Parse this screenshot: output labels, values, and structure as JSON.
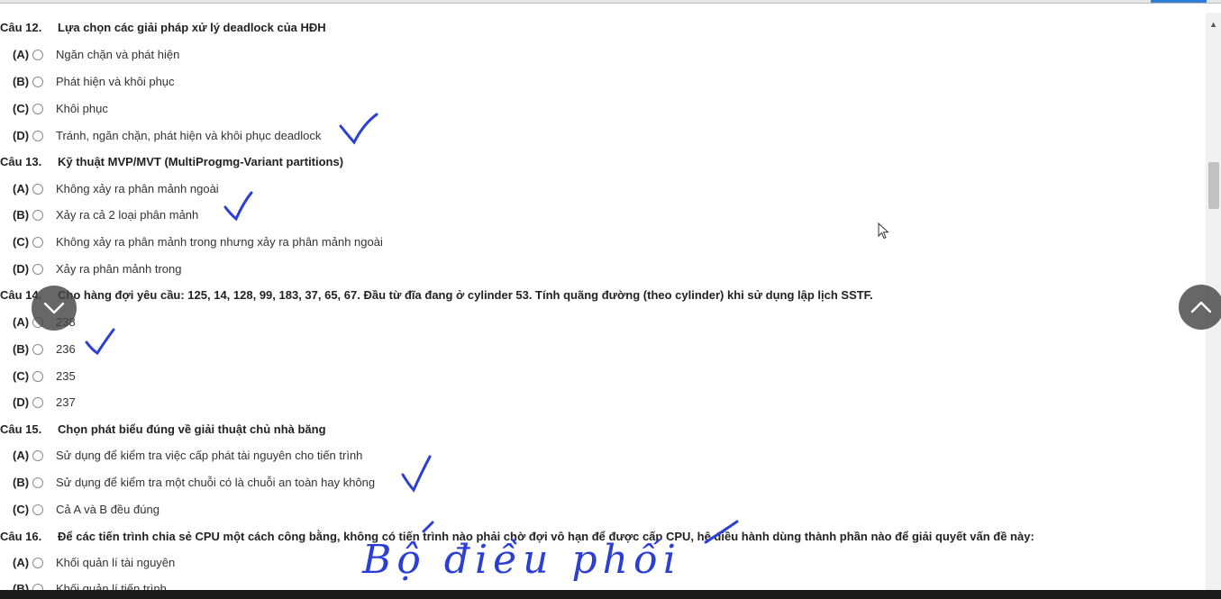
{
  "questions": [
    {
      "number": "Câu 12.",
      "text": "Lựa chọn các giải pháp xử lý deadlock của HĐH",
      "options": [
        {
          "letter": "(A)",
          "text": "Ngăn chặn và phát hiện"
        },
        {
          "letter": "(B)",
          "text": "Phát hiện và khôi phục"
        },
        {
          "letter": "(C)",
          "text": "Khôi phục"
        },
        {
          "letter": "(D)",
          "text": "Tránh, ngăn chặn, phát hiện và khôi phục deadlock"
        }
      ]
    },
    {
      "number": "Câu 13.",
      "text": "Kỹ thuật MVP/MVT (MultiProgmg-Variant partitions)",
      "options": [
        {
          "letter": "(A)",
          "text": "Không xảy ra phân mảnh ngoài"
        },
        {
          "letter": "(B)",
          "text": "Xảy ra cả 2 loại phân mảnh"
        },
        {
          "letter": "(C)",
          "text": "Không xảy ra phân mảnh trong nhưng xảy ra phân mảnh ngoài"
        },
        {
          "letter": "(D)",
          "text": "Xảy ra phân mảnh trong"
        }
      ]
    },
    {
      "number": "Câu 14.",
      "text": "Cho hàng đợi yêu cầu: 125, 14, 128, 99, 183, 37, 65, 67. Đầu từ đĩa đang ở cylinder 53. Tính quãng đường (theo cylinder) khi sử dụng lập lịch SSTF.",
      "options": [
        {
          "letter": "(A)",
          "text": "238"
        },
        {
          "letter": "(B)",
          "text": "236"
        },
        {
          "letter": "(C)",
          "text": "235"
        },
        {
          "letter": "(D)",
          "text": "237"
        }
      ]
    },
    {
      "number": "Câu 15.",
      "text": "Chọn phát biểu đúng về giải thuật chủ nhà băng",
      "options": [
        {
          "letter": "(A)",
          "text": "Sử dụng để kiểm tra việc cấp phát tài nguyên cho tiến trình"
        },
        {
          "letter": "(B)",
          "text": "Sử dụng để kiểm tra một chuỗi có là chuỗi an toàn hay không"
        },
        {
          "letter": "(C)",
          "text": "Cả A và B đều đúng"
        }
      ]
    },
    {
      "number": "Câu 16.",
      "text": "Để các tiến trình chia sẻ CPU một cách công bằng, không có tiến trình nào phải chờ đợi vô hạn để được cấp CPU, hệ điều hành dùng thành phần nào để giải quyết vấn đề này:",
      "options": [
        {
          "letter": "(A)",
          "text": "Khối quản lí tài nguyên"
        },
        {
          "letter": "(B)",
          "text": "Khối quản lí tiến trình"
        }
      ]
    }
  ],
  "handwriting": "Bộ điều phối",
  "icons": {
    "scroll_down": "chevron-down-icon",
    "scroll_up": "chevron-up-icon"
  },
  "colors": {
    "ink": "#2b3fd6"
  }
}
